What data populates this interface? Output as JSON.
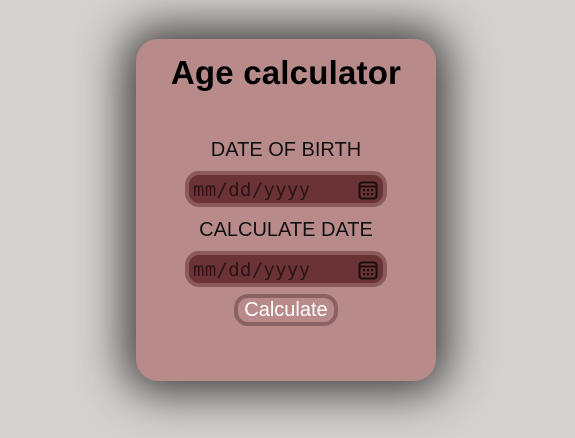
{
  "card": {
    "title": "Age calculator"
  },
  "form": {
    "dob_label": "DATE OF BIRTH",
    "dob_placeholder": "mm/dd/yyyy",
    "calc_date_label": "CALCULATE DATE",
    "calc_date_placeholder": "mm/dd/yyyy",
    "calculate_button": "Calculate"
  },
  "icons": {
    "date_picker": "calendar-icon"
  },
  "colors": {
    "page_background": "#d6d1d1",
    "card_background": "#b88a8a",
    "input_background": "#6b3336",
    "input_border": "#8a5a5c",
    "button_text": "#ffffff"
  }
}
